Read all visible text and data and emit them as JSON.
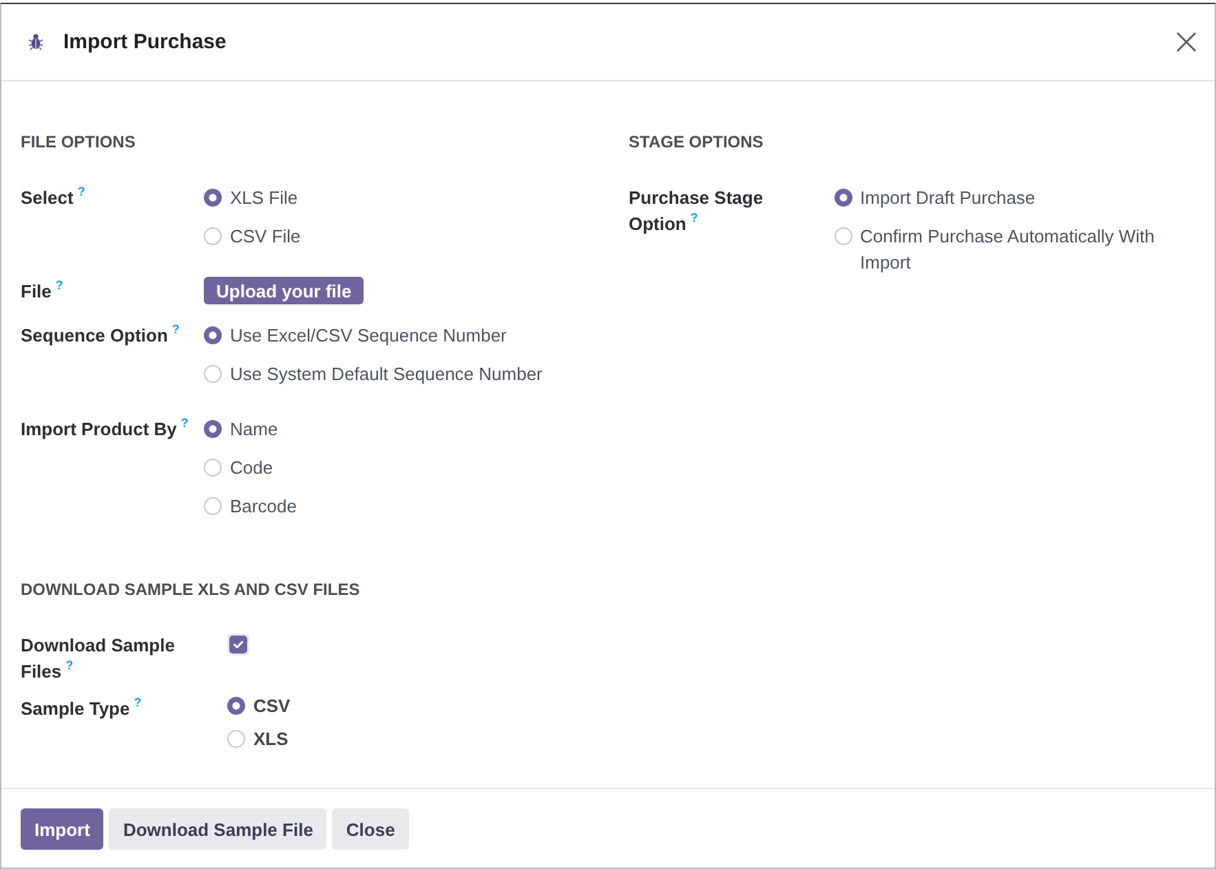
{
  "dialog": {
    "title": "Import Purchase"
  },
  "columns": [
    {
      "title": "FILE OPTIONS",
      "fields": [
        {
          "kind": "radio",
          "label": "Select",
          "help": "?",
          "options": [
            {
              "label": "XLS File",
              "selected": true
            },
            {
              "label": "CSV File",
              "selected": false
            }
          ]
        },
        {
          "kind": "upload",
          "label": "File",
          "help": "?",
          "button": "Upload your file"
        },
        {
          "kind": "radio",
          "label": "Sequence Option",
          "help": "?",
          "options": [
            {
              "label": "Use Excel/CSV Sequence Number",
              "selected": true
            },
            {
              "label": "Use System Default Sequence Number",
              "selected": false
            }
          ]
        },
        {
          "kind": "radio",
          "label": "Import Product By",
          "help": "?",
          "options": [
            {
              "label": "Name",
              "selected": true
            },
            {
              "label": "Code",
              "selected": false
            },
            {
              "label": "Barcode",
              "selected": false
            }
          ]
        }
      ]
    },
    {
      "title": "STAGE OPTIONS",
      "fields": [
        {
          "kind": "radio",
          "label": "Purchase Stage Option",
          "help": "?",
          "options": [
            {
              "label": "Import Draft Purchase",
              "selected": true
            },
            {
              "label": "Confirm Purchase Automatically With Import",
              "selected": false
            }
          ]
        }
      ]
    }
  ],
  "download_section": {
    "title": "DOWNLOAD SAMPLE XLS AND CSV FILES",
    "fields": [
      {
        "kind": "checkbox",
        "label": "Download Sample Files",
        "help": "?",
        "checked": true
      },
      {
        "kind": "radio",
        "label": "Sample Type",
        "help": "?",
        "options": [
          {
            "label": "CSV",
            "selected": true
          },
          {
            "label": "XLS",
            "selected": false
          }
        ]
      }
    ]
  },
  "footer": {
    "buttons": [
      {
        "label": "Import",
        "kind": "primary"
      },
      {
        "label": "Download Sample File",
        "kind": "secondary"
      },
      {
        "label": "Close",
        "kind": "secondary"
      }
    ]
  }
}
